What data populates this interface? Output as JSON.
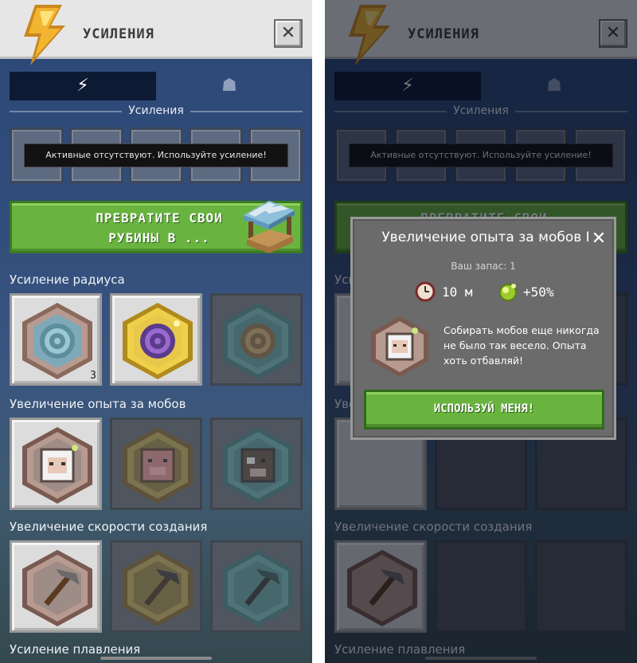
{
  "header": {
    "title": "УСИЛЕНИЯ",
    "close_glyph": "✕"
  },
  "tabs": [
    {
      "icon": "lightning-icon",
      "glyph": "⚡",
      "selected": true
    },
    {
      "icon": "mob-icon",
      "glyph": "☗",
      "selected": false
    }
  ],
  "boosts_section": {
    "caption": "Усиления",
    "empty_message": "Активные отсутствуют. Используйте усиление!"
  },
  "promo": {
    "text": "ПРЕВРАТИТЕ СВОИ РУБИНЫ В ..."
  },
  "categories": [
    {
      "title": "Усиление радиуса",
      "items": [
        {
          "icon": "radius-target-blue-icon",
          "active": true,
          "count": "3",
          "color": "#7fa8b8"
        },
        {
          "icon": "radius-target-purple-icon",
          "active": true,
          "count": "",
          "color": "#e8c84a"
        },
        {
          "icon": "radius-target-bronze-icon",
          "active": false,
          "count": "",
          "color": "#4e8c8c"
        }
      ]
    },
    {
      "title": "Увеличение опыта за мобов",
      "items": [
        {
          "icon": "sheep-face-icon",
          "active": true,
          "count": "",
          "color": "#9e8c86"
        },
        {
          "icon": "pig-face-icon",
          "active": false,
          "count": "",
          "color": "#a08a40"
        },
        {
          "icon": "cow-face-icon",
          "active": false,
          "count": "",
          "color": "#4e8c8c"
        }
      ]
    },
    {
      "title": "Увеличение скорости создания",
      "items": [
        {
          "icon": "pickaxe-icon",
          "active": true,
          "count": "",
          "color": "#9e8c86"
        },
        {
          "icon": "pickaxe-gold-icon",
          "active": false,
          "count": "",
          "color": "#a08a40"
        },
        {
          "icon": "pickaxe-diamond-icon",
          "active": false,
          "count": "",
          "color": "#4e8c8c"
        }
      ]
    },
    {
      "title": "Усиление плавления",
      "items": []
    }
  ],
  "modal": {
    "title": "Увеличение опыта за мобов I",
    "stock": "Ваш запас: 1",
    "duration": "10 м",
    "bonus": "+50%",
    "description": "Собирать мобов еще никогда не было так весело. Опыта хоть отбавляй!",
    "button": "ИСПОЛЬЗУЙ МЕНЯ!",
    "close_glyph": "✕"
  }
}
